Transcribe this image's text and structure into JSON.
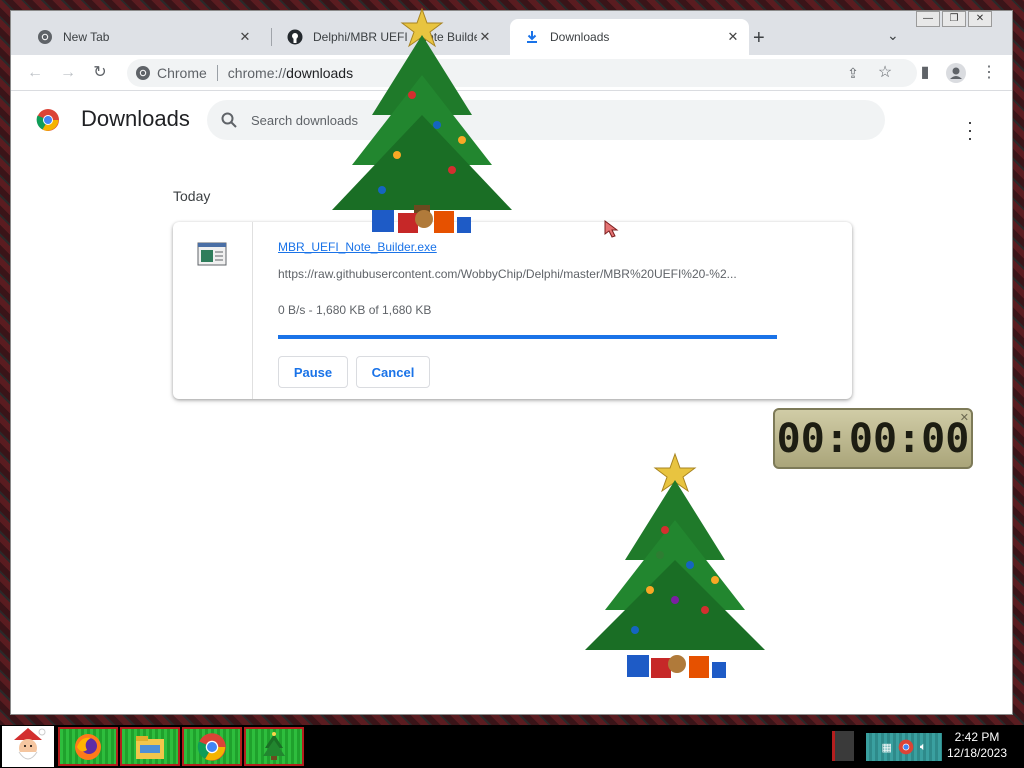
{
  "tabs": [
    {
      "title": "New Tab",
      "icon": "chrome-icon"
    },
    {
      "title": "Delphi/MBR UEFI - Note Builder",
      "icon": "github-icon"
    },
    {
      "title": "Downloads",
      "icon": "download-icon"
    }
  ],
  "toolbar": {
    "site_label": "Chrome",
    "url_prefix": "chrome://",
    "url_host": "downloads"
  },
  "downloads_page": {
    "title": "Downloads",
    "search_placeholder": "Search downloads",
    "date_label": "Today"
  },
  "download_item": {
    "file_name": "MBR_UEFI_Note_Builder.exe",
    "url": "https://raw.githubusercontent.com/WobbyChip/Delphi/master/MBR%20UEFI%20-%2...",
    "status": "0 B/s - 1,680 KB of 1,680 KB",
    "progress_fraction": 1.0,
    "pause_label": "Pause",
    "cancel_label": "Cancel"
  },
  "clock_widget": {
    "time": "00:00:00"
  },
  "taskbar": {
    "time": "2:42 PM",
    "date": "12/18/2023"
  },
  "colors": {
    "accent": "#1a73e8",
    "taskbar_button": "#2ebd3d",
    "taskbar_border": "#b41e1e"
  }
}
